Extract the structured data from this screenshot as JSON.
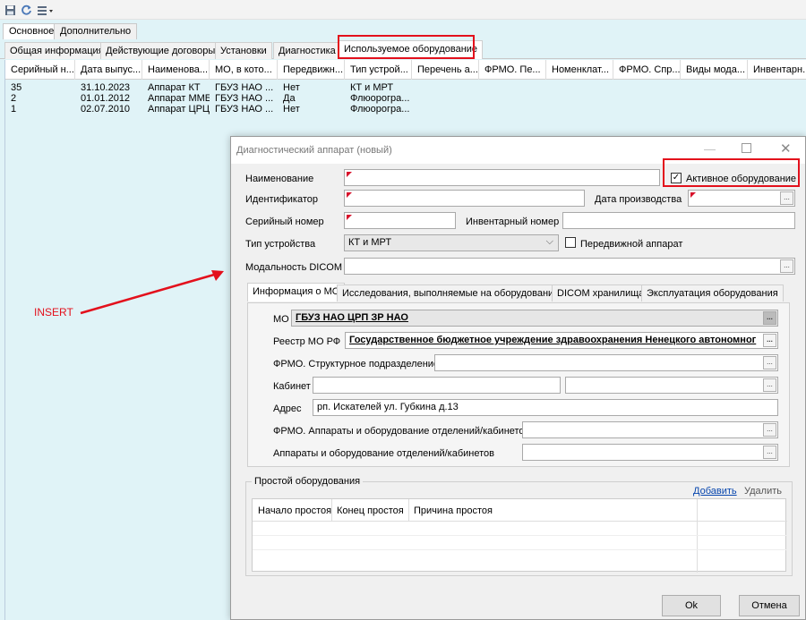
{
  "toolbar": {
    "save_icon": "save-icon",
    "refresh_icon": "refresh-icon",
    "export_icon": "export-menu-icon"
  },
  "top_tabs": [
    "Основное",
    "Дополнительно"
  ],
  "sub_tabs": [
    "Общая информация",
    "Действующие договоры",
    "Установки",
    "Диагностика",
    "Используемое оборудование"
  ],
  "grid": {
    "columns": [
      "Серийный н...",
      "Дата выпус...",
      "Наименова...",
      "МО, в кото...",
      "Передвижн...",
      "Тип устрой...",
      "Перечень а...",
      "ФРМО. Пе...",
      "Номенклат...",
      "ФРМО. Спр...",
      "Виды мода...",
      "Инвентарн..."
    ],
    "rows": [
      [
        "35",
        "31.10.2023",
        "Аппарат КТ",
        "ГБУЗ НАО ...",
        "Нет",
        "КТ и МРТ"
      ],
      [
        "2",
        "01.01.2012",
        "Аппарат ММБ",
        "ГБУЗ НАО ...",
        "Да",
        "Флюорогра..."
      ],
      [
        "1",
        "02.07.2010",
        "Аппарат ЦРЦ",
        "ГБУЗ НАО ...",
        "Нет",
        "Флюорогра..."
      ]
    ]
  },
  "annotation": {
    "label": "INSERT",
    "color": "#e3101c"
  },
  "dialog": {
    "title": "Диагностический аппарат (новый)",
    "fields": {
      "name_label": "Наименование",
      "active_label": "Активное оборудование",
      "active_checked": "✓",
      "identifier_label": "Идентификатор",
      "prod_date_label": "Дата производства",
      "serial_label": "Серийный номер",
      "inventory_label": "Инвентарный номер",
      "device_type_label": "Тип устройства",
      "device_type_value": "КТ и МРТ",
      "mobile_label": "Передвижной аппарат",
      "dicom_label": "Модальность DICOM",
      "ellipsis": "..."
    },
    "inner_tabs": [
      "Информация о МО",
      "Исследования, выполняемые на оборудовании",
      "DICOM хранилища",
      "Эксплуатация оборудования"
    ],
    "mo_info": {
      "mo_label": "МО",
      "mo_value": "ГБУЗ НАО ЦРП ЗР НАО",
      "registry_label": "Реестр МО РФ",
      "registry_value": "Государственное бюджетное учреждение здравоохранения Ненецкого автономног",
      "structural_label": "ФРМО. Структурное подразделение",
      "cabinet_label": "Кабинет",
      "address_label": "Адрес",
      "address_value": "рп. Искателей ул. Губкина д.13",
      "frmo_equipment_label": "ФРМО. Аппараты и оборудование отделений/кабинетов",
      "equipment_label": "Аппараты и оборудование отделений/кабинетов"
    },
    "downtime": {
      "group_label": "Простой оборудования",
      "add_label": "Добавить",
      "delete_label": "Удалить",
      "columns": [
        "Начало простоя",
        "Конец простоя",
        "Причина простоя"
      ]
    },
    "buttons": {
      "ok": "Ok",
      "cancel": "Отмена"
    }
  }
}
